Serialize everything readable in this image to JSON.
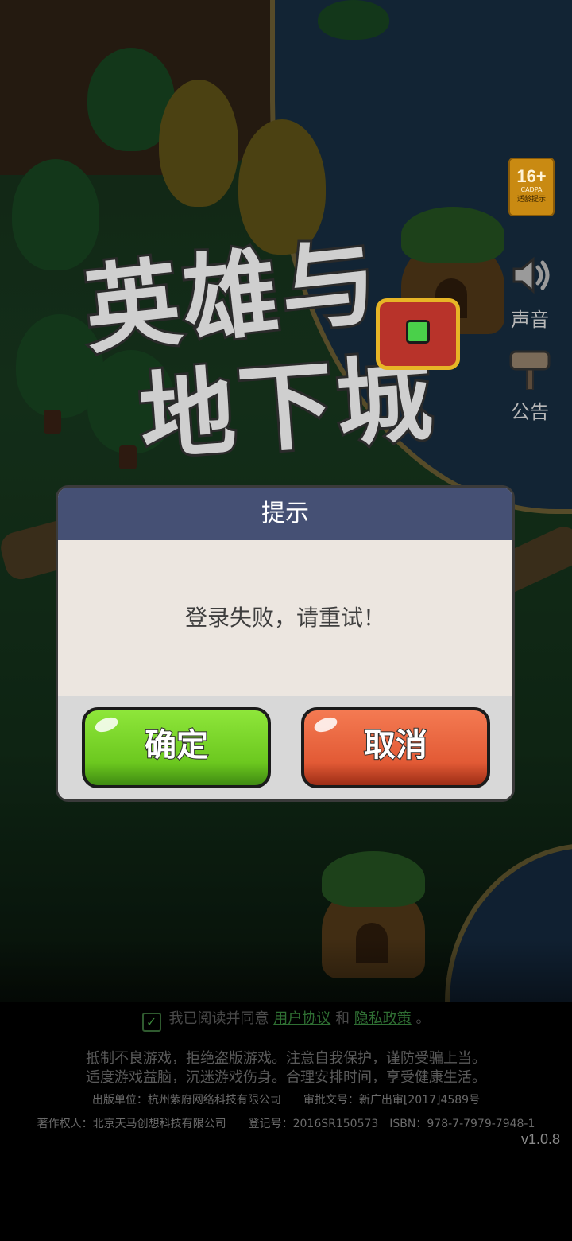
{
  "game": {
    "title_line1": "英雄与",
    "title_line2": "地下城"
  },
  "side": {
    "age_rating": "16+",
    "age_org": "CADPA",
    "age_tip": "适龄提示",
    "sound_label": "声音",
    "notice_label": "公告",
    "icons": [
      "speaker-icon",
      "signpost-icon"
    ]
  },
  "dialog": {
    "title": "提示",
    "message": "登录失败，请重试！",
    "confirm_label": "确定",
    "cancel_label": "取消",
    "colors": {
      "header": "#455074",
      "confirm": "#6cc81f",
      "cancel": "#e25a35"
    }
  },
  "footer": {
    "agree_prefix": "我已阅读并同意",
    "user_agreement": "用户协议",
    "and": "和",
    "privacy_policy": "隐私政策",
    "agree_suffix": "。",
    "agreed": true,
    "notice_line1": "抵制不良游戏，拒绝盗版游戏。注意自我保护，谨防受骗上当。",
    "notice_line2": "适度游戏益脑，沉迷游戏伤身。合理安排时间，享受健康生活。",
    "publisher_line": "出版单位：杭州紫府网络科技有限公司　　审批文号：新广出审[2017]4589号",
    "copyright_line": "著作权人：北京天马创想科技有限公司　　登记号：2016SR150573　ISBN：978-7-7979-7948-1",
    "version": "v1.0.8"
  }
}
